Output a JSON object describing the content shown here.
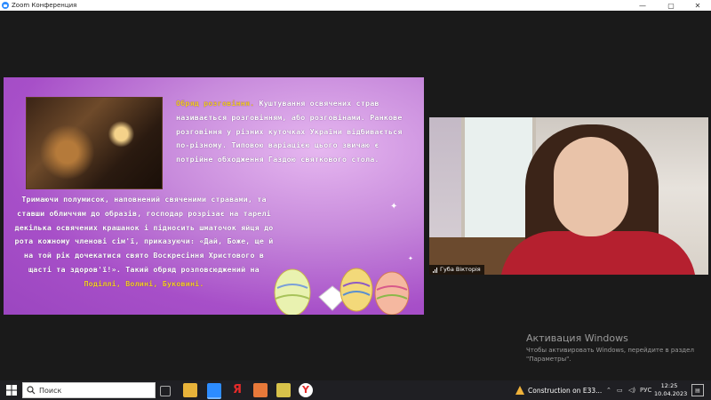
{
  "window": {
    "title": "Zoom Конференция",
    "minimize": "—",
    "maximize": "▢",
    "close": "✕"
  },
  "slide": {
    "para1_highlight": "Обряд розговіння.",
    "para1_rest": " Куштування освячених страв називається розговінням, або розговінами. Ранкове розговіння у різних куточках України відбивається по-різному. Типовою варіацією цього звичаю є потрійне обходження Газдою святкового стола.",
    "para2_text": "Тримаючи полумисок, наповнений свяченими стравами, та ставши обличчям до образів, господар розрізає на тарелі декілька освячених крашанок і підносить шматочок яйця до рота кожному членові сім'ї, приказуючи: «Дай, Боже, ще й на той рік дочекатися свято Воскресіння Христового в щасті та здоров'ї!». Такий обряд розповсюджений на ",
    "para2_highlight": "Поділлі, Волині, Буковині."
  },
  "participant": {
    "name": "Губа Вікторія"
  },
  "watermark": {
    "title": "Активация Windows",
    "line1": "Чтобы активировать Windows, перейдите в раздел",
    "line2": "\"Параметры\"."
  },
  "taskbar": {
    "search_label": "Поиск",
    "notification_label": "Construction on E33...",
    "language": "РУС",
    "time": "12:25",
    "date": "10.04.2023"
  },
  "colors": {
    "slide_purple": "#a74fc8",
    "highlight_yellow": "#f4cc2a",
    "zoom_blue": "#2d8cff",
    "sweater_red": "#b5202f"
  }
}
